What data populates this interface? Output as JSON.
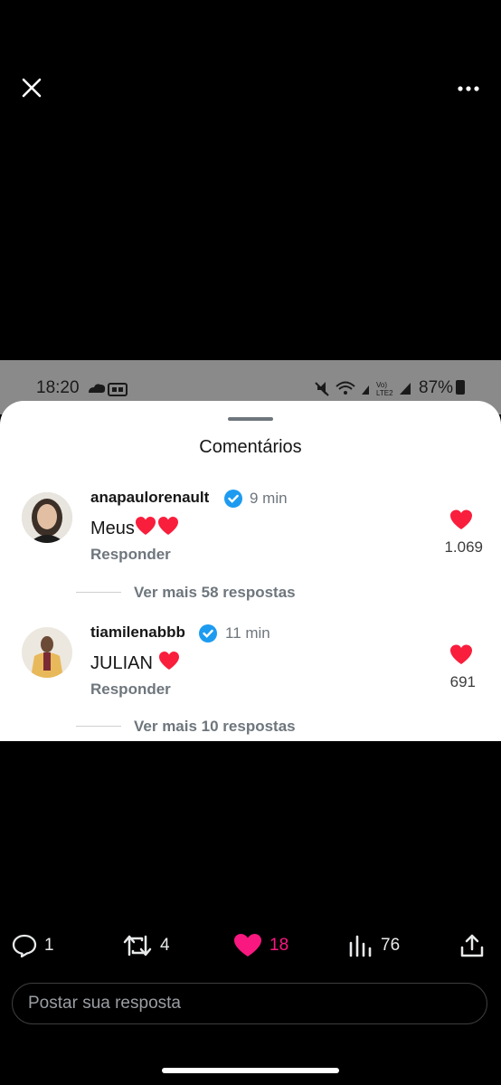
{
  "status_bar": {
    "time": "18:20",
    "battery": "87%"
  },
  "sheet": {
    "title": "Comentários"
  },
  "comments": [
    {
      "username": "anapaulorenault",
      "time": "9 min",
      "text": "Meus",
      "reply_label": "Responder",
      "likes": "1.069",
      "more_replies": "Ver mais 58 respostas"
    },
    {
      "username": "tiamilenabbb",
      "time": "11 min",
      "text": "JULIAN",
      "reply_label": "Responder",
      "likes": "691",
      "more_replies": "Ver mais 10 respostas"
    }
  ],
  "actions": {
    "replies": "1",
    "reposts": "4",
    "likes": "18",
    "views": "76"
  },
  "reply_input": {
    "placeholder": "Postar sua resposta"
  },
  "colors": {
    "like_pink": "#f91880",
    "heart_red": "#f91e3c",
    "verified_blue": "#1d9bf0",
    "background": "#000000",
    "sheet": "#ffffff"
  },
  "icons": [
    "close-icon",
    "more-icon",
    "verified-badge-icon",
    "heart-icon",
    "comment-icon",
    "repost-icon",
    "views-icon",
    "share-icon"
  ]
}
